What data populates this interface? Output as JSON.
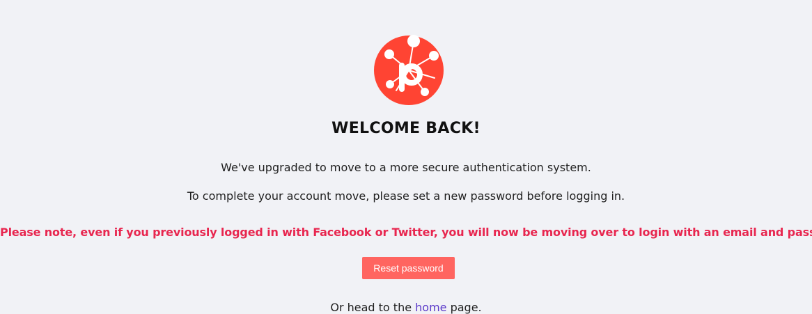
{
  "logo": {
    "icon": "network-p-logo",
    "color": "#ff4433"
  },
  "heading": "WELCOME BACK!",
  "messages": {
    "upgrade": "We've upgraded to move to a more secure authentication system.",
    "instruction": "To complete your account move, please set a new password before logging in."
  },
  "notice": {
    "text": "Please note, even if you previously logged in with Facebook or Twitter, you will now be moving over to login with an email and password.",
    "color": "#e8264f"
  },
  "reset_button": {
    "label": "Reset password",
    "color": "#ff6560"
  },
  "footer": {
    "prefix": "Or head to the ",
    "link_text": "home",
    "suffix": "page."
  }
}
